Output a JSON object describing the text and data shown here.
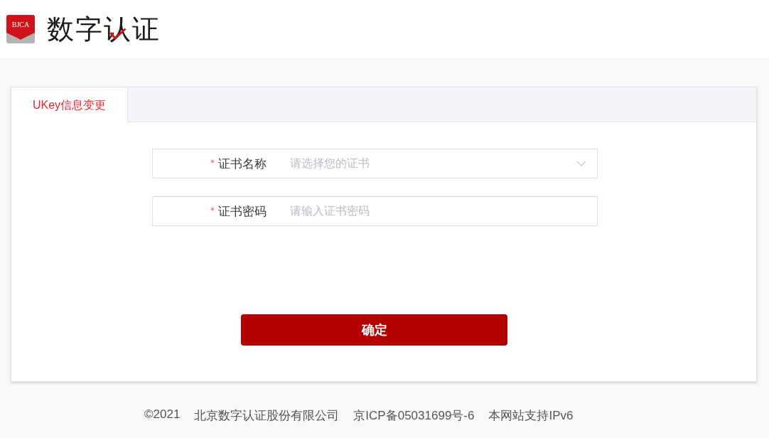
{
  "header": {
    "logo": {
      "badge": "BJCA",
      "name": "数字认证"
    }
  },
  "tabs": [
    {
      "label": "UKey信息变更",
      "selected": true
    }
  ],
  "form": {
    "fields": [
      {
        "kind": "select",
        "label": "证书名称",
        "required": true,
        "placeholder": "请选择您的证书"
      },
      {
        "kind": "password",
        "label": "证书密码",
        "required": true,
        "placeholder": "请输入证书密码"
      }
    ],
    "submit": "确定"
  },
  "footer": [
    "©2021",
    "北京数字认证股份有限公司",
    "京ICP备05031699号-6",
    "本网站支持IPv6"
  ]
}
